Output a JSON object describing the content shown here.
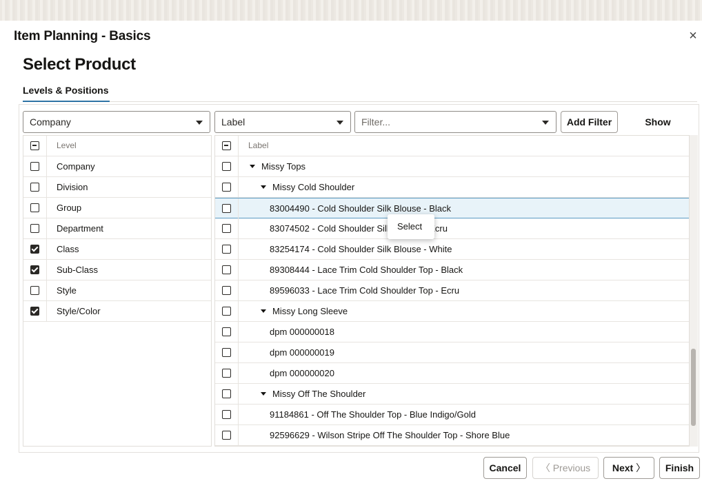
{
  "dialog": {
    "title": "Item Planning - Basics",
    "close_label": "×"
  },
  "section": {
    "title": "Select Product"
  },
  "tabs": [
    {
      "label": "Levels & Positions"
    }
  ],
  "toolbar": {
    "level_dropdown": "Company",
    "attribute_dropdown": "Label",
    "filter_placeholder": "Filter...",
    "add_filter_label": "Add Filter",
    "show_selected_label": "Show Selected"
  },
  "levels_grid": {
    "header": "Level",
    "rows": [
      {
        "label": "Company",
        "checked": false
      },
      {
        "label": "Division",
        "checked": false
      },
      {
        "label": "Group",
        "checked": false
      },
      {
        "label": "Department",
        "checked": false
      },
      {
        "label": "Class",
        "checked": true
      },
      {
        "label": "Sub-Class",
        "checked": true
      },
      {
        "label": "Style",
        "checked": false
      },
      {
        "label": "Style/Color",
        "checked": true
      }
    ]
  },
  "positions_grid": {
    "header": "Label",
    "rows": [
      {
        "label": "Missy Tops",
        "depth": 0,
        "expandable": true
      },
      {
        "label": "Missy Cold Shoulder",
        "depth": 1,
        "expandable": true
      },
      {
        "label": "83004490 - Cold Shoulder Silk Blouse - Black",
        "depth": 2,
        "expandable": false,
        "selected": true
      },
      {
        "label": "83074502 - Cold Shoulder Silk Blouse - Ecru",
        "depth": 2,
        "expandable": false
      },
      {
        "label": "83254174 - Cold Shoulder Silk Blouse - White",
        "depth": 2,
        "expandable": false
      },
      {
        "label": "89308444 - Lace Trim Cold Shoulder Top - Black",
        "depth": 2,
        "expandable": false
      },
      {
        "label": "89596033 - Lace Trim Cold Shoulder Top - Ecru",
        "depth": 2,
        "expandable": false
      },
      {
        "label": "Missy Long Sleeve",
        "depth": 1,
        "expandable": true
      },
      {
        "label": "dpm 000000018",
        "depth": 2,
        "expandable": false
      },
      {
        "label": "dpm 000000019",
        "depth": 2,
        "expandable": false
      },
      {
        "label": "dpm 000000020",
        "depth": 2,
        "expandable": false
      },
      {
        "label": "Missy Off The Shoulder",
        "depth": 1,
        "expandable": true
      },
      {
        "label": "91184861 - Off The Shoulder Top - Blue Indigo/Gold",
        "depth": 2,
        "expandable": false
      },
      {
        "label": "92596629 - Wilson Stripe Off The Shoulder Top - Shore Blue",
        "depth": 2,
        "expandable": false
      }
    ]
  },
  "context_menu": {
    "items": [
      {
        "label": "Select"
      }
    ]
  },
  "footer": {
    "cancel_label": "Cancel",
    "previous_label": "Previous",
    "next_label": "Next",
    "finish_label": "Finish",
    "previous_chevron": "〈",
    "next_chevron": "〉"
  },
  "colors": {
    "accent": "#2e73a5",
    "selected_row_bg": "#e8f3f9",
    "selected_row_border": "#5a9ac3"
  }
}
